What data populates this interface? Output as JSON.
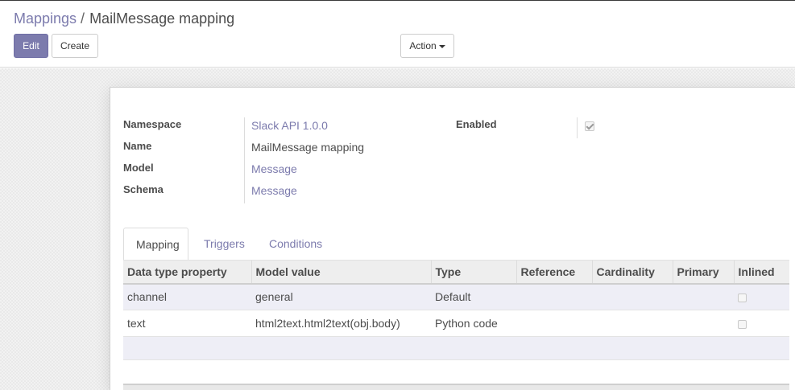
{
  "breadcrumb": {
    "parent": "Mappings",
    "separator": "/",
    "current": "MailMessage mapping"
  },
  "buttons": {
    "edit": "Edit",
    "create": "Create",
    "action": "Action"
  },
  "form": {
    "fields": {
      "namespace": {
        "label": "Namespace",
        "value": "Slack API 1.0.0"
      },
      "name": {
        "label": "Name",
        "value": "MailMessage mapping"
      },
      "model": {
        "label": "Model",
        "value": "Message"
      },
      "schema": {
        "label": "Schema",
        "value": "Message"
      },
      "enabled": {
        "label": "Enabled",
        "checked": true
      }
    }
  },
  "tabs": [
    {
      "label": "Mapping",
      "active": true
    },
    {
      "label": "Triggers",
      "active": false
    },
    {
      "label": "Conditions",
      "active": false
    }
  ],
  "table": {
    "columns": [
      "Data type property",
      "Model value",
      "Type",
      "Reference",
      "Cardinality",
      "Primary",
      "Inlined"
    ],
    "rows": [
      {
        "property": "channel",
        "model_value": "general",
        "type": "Default",
        "reference": "",
        "cardinality": "",
        "primary": "",
        "inlined": false
      },
      {
        "property": "text",
        "model_value": "html2text.html2text(obj.body)",
        "type": "Python code",
        "reference": "",
        "cardinality": "",
        "primary": "",
        "inlined": false
      }
    ]
  },
  "colors": {
    "accent": "#7c7bad",
    "text": "#4c4c4c",
    "row_highlight": "#eeeef6"
  }
}
